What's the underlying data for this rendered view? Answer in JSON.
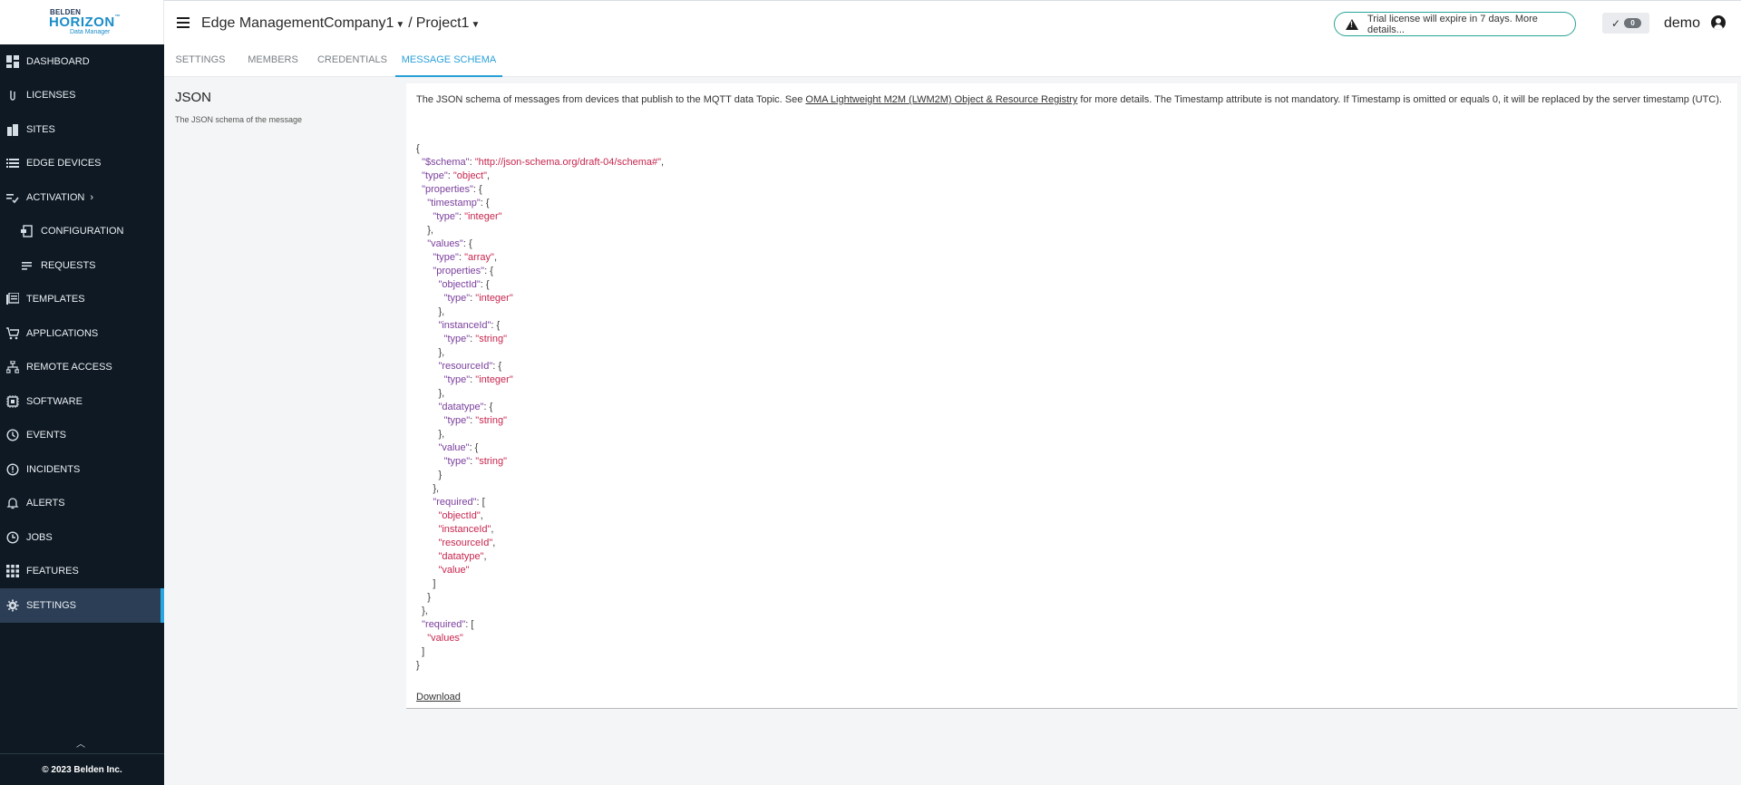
{
  "brand": {
    "top": "BELDEN",
    "name": "HORIZON",
    "tm": "™",
    "sub": "Data Manager"
  },
  "sidebar": {
    "items": [
      {
        "label": "DASHBOARD",
        "icon": "dashboard-icon"
      },
      {
        "label": "LICENSES",
        "icon": "license-icon"
      },
      {
        "label": "SITES",
        "icon": "sites-icon"
      },
      {
        "label": "EDGE DEVICES",
        "icon": "list-icon"
      },
      {
        "label": "ACTIVATION",
        "icon": "activation-icon",
        "chevron": "›"
      },
      {
        "label": "CONFIGURATION",
        "icon": "configuration-icon"
      },
      {
        "label": "REQUESTS",
        "icon": "requests-icon"
      },
      {
        "label": "TEMPLATES",
        "icon": "templates-icon"
      },
      {
        "label": "APPLICATIONS",
        "icon": "cart-icon"
      },
      {
        "label": "REMOTE ACCESS",
        "icon": "network-icon"
      },
      {
        "label": "SOFTWARE",
        "icon": "chip-icon"
      },
      {
        "label": "EVENTS",
        "icon": "history-icon"
      },
      {
        "label": "INCIDENTS",
        "icon": "alert-circle-icon"
      },
      {
        "label": "ALERTS",
        "icon": "bell-icon"
      },
      {
        "label": "JOBS",
        "icon": "clock-icon"
      },
      {
        "label": "FEATURES",
        "icon": "grid-icon"
      },
      {
        "label": "SETTINGS",
        "icon": "gear-icon"
      }
    ],
    "footer": "© 2023 Belden Inc."
  },
  "topbar": {
    "title": "Edge Management",
    "company": "Company1",
    "separator": "/",
    "project": "Project1",
    "trial": "Trial license will expire in 7 days. More details...",
    "status_count": "0",
    "user": "demo"
  },
  "tabs": [
    {
      "label": "SETTINGS"
    },
    {
      "label": "MEMBERS"
    },
    {
      "label": "CREDENTIALS"
    },
    {
      "label": "MESSAGE SCHEMA"
    }
  ],
  "left": {
    "heading": "JSON",
    "description": "The JSON schema of the message"
  },
  "main": {
    "intro_pre": "The JSON schema of messages from devices that publish to the MQTT data Topic. See ",
    "intro_link": "OMA Lightweight M2M (LWM2M) Object & Resource Registry",
    "intro_post": " for more details. The Timestamp attribute is not mandatory. If Timestamp is omitted or equals 0, it will be replaced by the server timestamp (UTC).",
    "download": "Download",
    "code_lines": [
      {
        "i": "",
        "k": "",
        "m": "{",
        "s": "",
        "e": ""
      },
      {
        "i": "  ",
        "k": "\"$schema\"",
        "m": ": ",
        "s": "\"http://json-schema.org/draft-04/schema#\"",
        "e": ","
      },
      {
        "i": "  ",
        "k": "\"type\"",
        "m": ": ",
        "s": "\"object\"",
        "e": ","
      },
      {
        "i": "  ",
        "k": "\"properties\"",
        "m": ": {",
        "s": "",
        "e": ""
      },
      {
        "i": "    ",
        "k": "\"timestamp\"",
        "m": ": {",
        "s": "",
        "e": ""
      },
      {
        "i": "      ",
        "k": "\"type\"",
        "m": ": ",
        "s": "\"integer\"",
        "e": ""
      },
      {
        "i": "    ",
        "k": "",
        "m": "},",
        "s": "",
        "e": ""
      },
      {
        "i": "    ",
        "k": "\"values\"",
        "m": ": {",
        "s": "",
        "e": ""
      },
      {
        "i": "      ",
        "k": "\"type\"",
        "m": ": ",
        "s": "\"array\"",
        "e": ","
      },
      {
        "i": "      ",
        "k": "\"properties\"",
        "m": ": {",
        "s": "",
        "e": ""
      },
      {
        "i": "        ",
        "k": "\"objectId\"",
        "m": ": {",
        "s": "",
        "e": ""
      },
      {
        "i": "          ",
        "k": "\"type\"",
        "m": ": ",
        "s": "\"integer\"",
        "e": ""
      },
      {
        "i": "        ",
        "k": "",
        "m": "},",
        "s": "",
        "e": ""
      },
      {
        "i": "        ",
        "k": "\"instanceId\"",
        "m": ": {",
        "s": "",
        "e": ""
      },
      {
        "i": "          ",
        "k": "\"type\"",
        "m": ": ",
        "s": "\"string\"",
        "e": ""
      },
      {
        "i": "        ",
        "k": "",
        "m": "},",
        "s": "",
        "e": ""
      },
      {
        "i": "        ",
        "k": "\"resourceId\"",
        "m": ": {",
        "s": "",
        "e": ""
      },
      {
        "i": "          ",
        "k": "\"type\"",
        "m": ": ",
        "s": "\"integer\"",
        "e": ""
      },
      {
        "i": "        ",
        "k": "",
        "m": "},",
        "s": "",
        "e": ""
      },
      {
        "i": "        ",
        "k": "\"datatype\"",
        "m": ": {",
        "s": "",
        "e": ""
      },
      {
        "i": "          ",
        "k": "\"type\"",
        "m": ": ",
        "s": "\"string\"",
        "e": ""
      },
      {
        "i": "        ",
        "k": "",
        "m": "},",
        "s": "",
        "e": ""
      },
      {
        "i": "        ",
        "k": "\"value\"",
        "m": ": {",
        "s": "",
        "e": ""
      },
      {
        "i": "          ",
        "k": "\"type\"",
        "m": ": ",
        "s": "\"string\"",
        "e": ""
      },
      {
        "i": "        ",
        "k": "",
        "m": "}",
        "s": "",
        "e": ""
      },
      {
        "i": "      ",
        "k": "",
        "m": "},",
        "s": "",
        "e": ""
      },
      {
        "i": "      ",
        "k": "\"required\"",
        "m": ": [",
        "s": "",
        "e": ""
      },
      {
        "i": "        ",
        "k": "",
        "m": "",
        "s": "\"objectId\"",
        "e": ","
      },
      {
        "i": "        ",
        "k": "",
        "m": "",
        "s": "\"instanceId\"",
        "e": ","
      },
      {
        "i": "        ",
        "k": "",
        "m": "",
        "s": "\"resourceId\"",
        "e": ","
      },
      {
        "i": "        ",
        "k": "",
        "m": "",
        "s": "\"datatype\"",
        "e": ","
      },
      {
        "i": "        ",
        "k": "",
        "m": "",
        "s": "\"value\"",
        "e": ""
      },
      {
        "i": "      ",
        "k": "",
        "m": "]",
        "s": "",
        "e": ""
      },
      {
        "i": "    ",
        "k": "",
        "m": "}",
        "s": "",
        "e": ""
      },
      {
        "i": "  ",
        "k": "",
        "m": "},",
        "s": "",
        "e": ""
      },
      {
        "i": "  ",
        "k": "\"required\"",
        "m": ": [",
        "s": "",
        "e": ""
      },
      {
        "i": "    ",
        "k": "",
        "m": "",
        "s": "\"values\"",
        "e": ""
      },
      {
        "i": "  ",
        "k": "",
        "m": "]",
        "s": "",
        "e": ""
      },
      {
        "i": "",
        "k": "",
        "m": "}",
        "s": "",
        "e": ""
      }
    ]
  }
}
